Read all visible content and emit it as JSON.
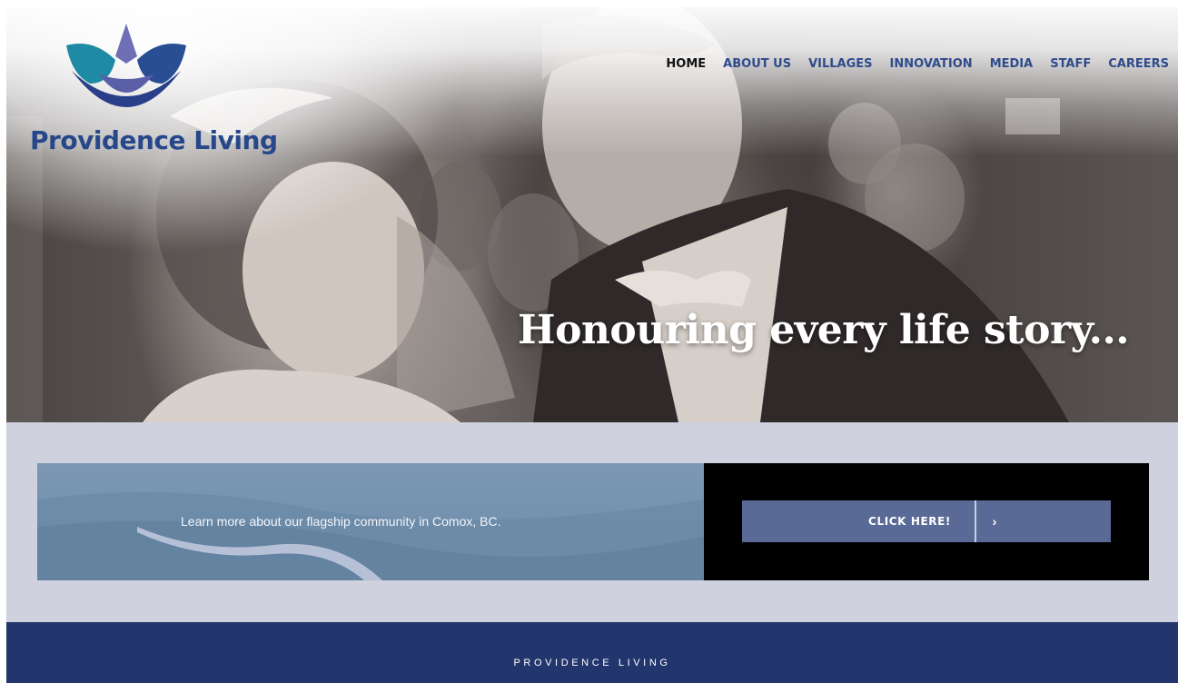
{
  "brand": {
    "name": "Providence Living",
    "logo_icon": "lotus-icon",
    "colors": {
      "primary": "#26488a",
      "teal": "#1e8aa3",
      "violet": "#6f6fb6",
      "footer": "#23356d"
    }
  },
  "nav": {
    "items": [
      {
        "label": "HOME",
        "active": true
      },
      {
        "label": "ABOUT US"
      },
      {
        "label": "VILLAGES"
      },
      {
        "label": "INNOVATION"
      },
      {
        "label": "MEDIA"
      },
      {
        "label": "STAFF"
      },
      {
        "label": "CAREERS"
      }
    ]
  },
  "hero": {
    "tagline": "Honouring every life story..."
  },
  "promo": {
    "text": "Learn more about our flagship community in Comox, BC.",
    "button_label": "CLICK HERE!",
    "button_icon": "chevron-right-icon",
    "button_icon_glyph": "›"
  },
  "footer": {
    "title": "PROVIDENCE LIVING"
  }
}
